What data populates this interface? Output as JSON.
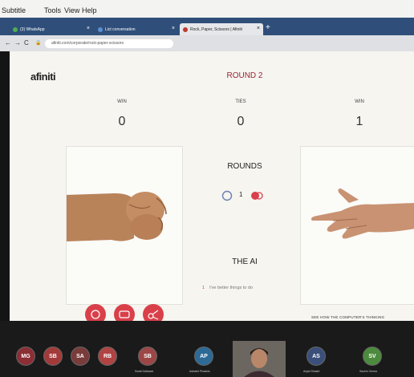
{
  "menu_bar": {
    "items": [
      "Subtitle",
      "Tools",
      "View",
      "Help"
    ]
  },
  "tabs": [
    {
      "label": "(3) WhatsApp",
      "active": false
    },
    {
      "label": "Lict conversation",
      "active": false
    },
    {
      "label": "Rock, Paper, Scissors | Afiniti",
      "active": true
    }
  ],
  "address_bar": {
    "url": "afiniti.com/corporate/rock-paper-scissors"
  },
  "game": {
    "logo": "afiniti",
    "round_title": "ROUND 2",
    "scores": [
      {
        "label": "WIN",
        "value": "0"
      },
      {
        "label": "TIES",
        "value": "0"
      },
      {
        "label": "WIN",
        "value": "1"
      }
    ],
    "rounds_title": "ROUNDS",
    "rounds_count": "1",
    "ai_title": "THE AI",
    "ai_message_num": "1",
    "ai_message": "I've better things to do",
    "see_link": "SEE HOW THE COMPUTER'S THINKING",
    "colors": {
      "accent": "#d9404a",
      "round_title": "#9b2335"
    }
  },
  "meeting": {
    "participants": [
      {
        "initials": "MG",
        "color": "#8c2e35",
        "name": ""
      },
      {
        "initials": "SB",
        "color": "#a33a3a",
        "name": ""
      },
      {
        "initials": "SA",
        "color": "#7a3b3b",
        "name": ""
      },
      {
        "initials": "RB",
        "color": "#b04343",
        "name": ""
      },
      {
        "initials": "SB",
        "color": "#9c4646",
        "name": "Swati Gaikwad"
      },
      {
        "initials": "AP",
        "color": "#2d6a96",
        "name": "Ashwini Phadnis"
      },
      {
        "initials": "AS",
        "color": "#3a4f7a",
        "name": "Anjali Shastri"
      },
      {
        "initials": "SV",
        "color": "#4c8a3e",
        "name": "Sachin Verma"
      }
    ]
  }
}
